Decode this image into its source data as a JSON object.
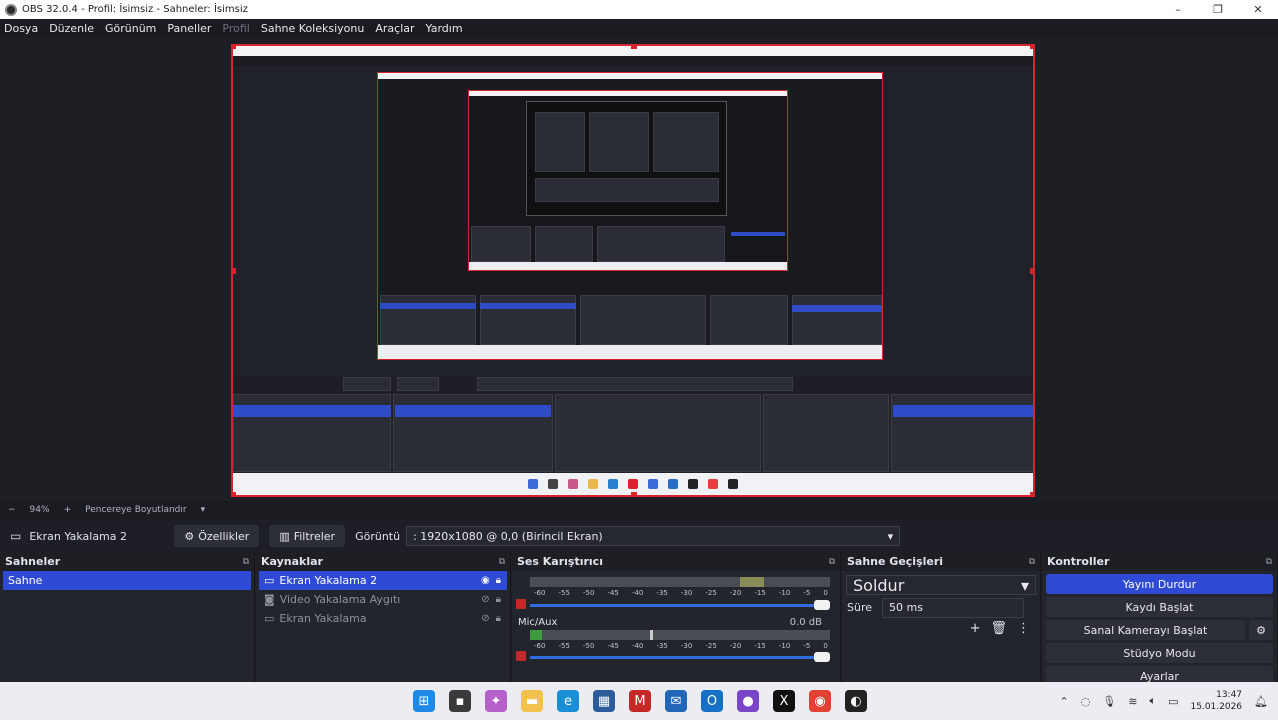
{
  "window": {
    "title": "OBS 32.0.4 - Profil: İsimsiz - Sahneler: İsimsiz",
    "min": "–",
    "max": "❐",
    "close": "✕"
  },
  "menu": [
    "Dosya",
    "Düzenle",
    "Görünüm",
    "Paneller",
    "Profil",
    "Sahne Koleksiyonu",
    "Araçlar",
    "Yardım"
  ],
  "zoom": {
    "minus": "−",
    "value": "94%",
    "plus": "+",
    "fit": "Pencereye Boyutlandır"
  },
  "source_bar": {
    "source": "Ekran Yakalama 2",
    "properties": "Özellikler",
    "filters": "Filtreler",
    "display_label": "Görüntü",
    "display_value": ": 1920x1080 @ 0,0 (Birincil Ekran)"
  },
  "scenes": {
    "title": "Sahneler",
    "items": [
      "Sahne"
    ]
  },
  "sources": {
    "title": "Kaynaklar",
    "items": [
      "Ekran Yakalama 2",
      "Video Yakalama Aygıtı",
      "Ekran Yakalama"
    ]
  },
  "mixer": {
    "title": "Ses Karıştırıcı",
    "tracks": [
      {
        "name": "",
        "db": ""
      },
      {
        "name": "Mic/Aux",
        "db": "0.0 dB"
      }
    ],
    "scale": [
      "-60",
      "-55",
      "-50",
      "-45",
      "-40",
      "-35",
      "-30",
      "-25",
      "-20",
      "-15",
      "-10",
      "-5",
      "0"
    ]
  },
  "transitions": {
    "title": "Sahne Geçişleri",
    "type": "Soldur",
    "duration_label": "Süre",
    "duration": "50 ms"
  },
  "controls": {
    "title": "Kontroller",
    "buttons": [
      "Yayını Durdur",
      "Kaydı Başlat",
      "Sanal Kamerayı Başlat",
      "Stüdyo Modu",
      "Ayarlar"
    ]
  },
  "clock": {
    "time": "13:47",
    "date": "15.01.2026"
  },
  "colors": {
    "accent": "#2f4bd6",
    "selection_border": "#d9232f"
  }
}
